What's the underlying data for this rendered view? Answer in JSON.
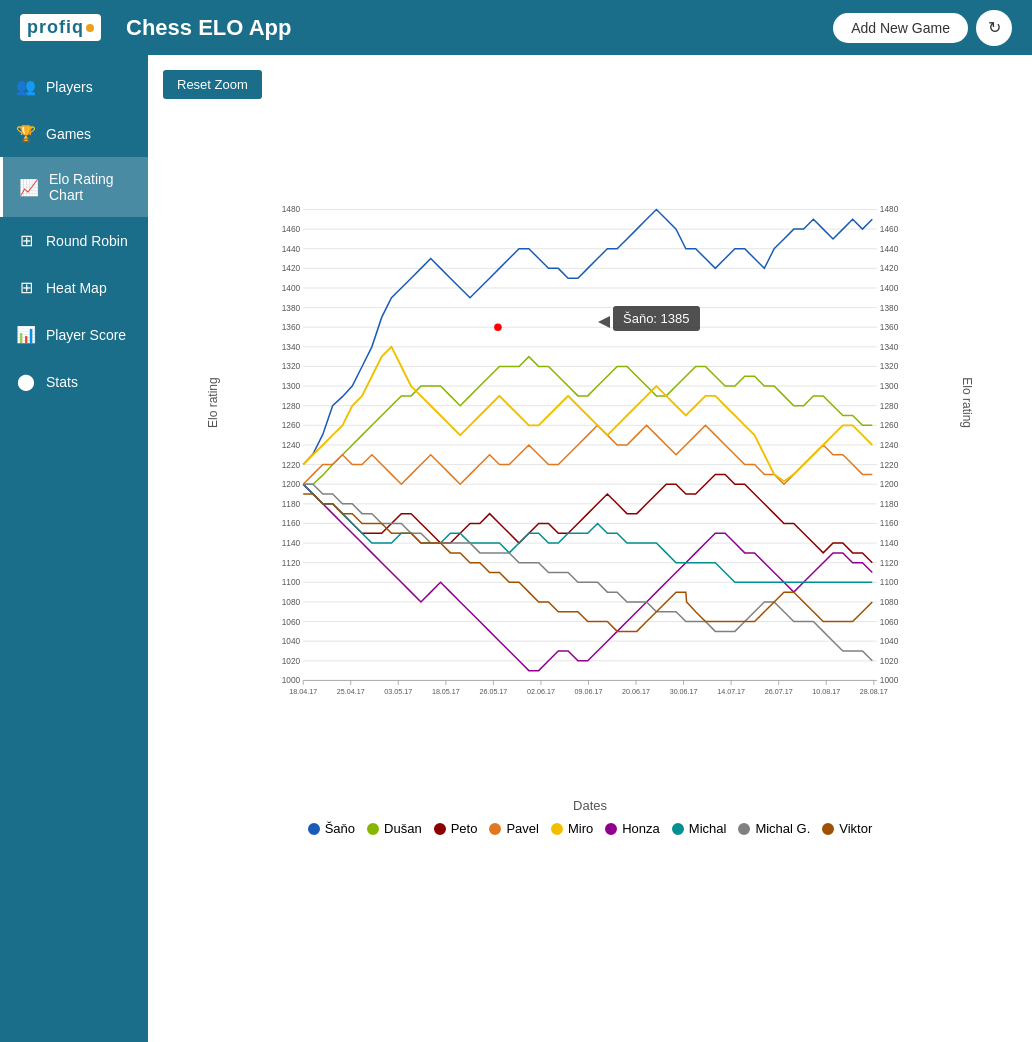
{
  "header": {
    "logo_text": "profiq",
    "app_title": "Chess ELO App",
    "add_game_label": "Add New Game",
    "refresh_icon": "↻"
  },
  "sidebar": {
    "items": [
      {
        "id": "players",
        "label": "Players",
        "icon": "👥",
        "active": false
      },
      {
        "id": "games",
        "label": "Games",
        "icon": "🏆",
        "active": false
      },
      {
        "id": "elo-rating-chart",
        "label": "Elo Rating Chart",
        "icon": "📈",
        "active": true
      },
      {
        "id": "round-robin",
        "label": "Round Robin",
        "icon": "⊞",
        "active": false
      },
      {
        "id": "heat-map",
        "label": "Heat Map",
        "icon": "⊞",
        "active": false
      },
      {
        "id": "player-score",
        "label": "Player Score",
        "icon": "📊",
        "active": false
      },
      {
        "id": "stats",
        "label": "Stats",
        "icon": "⬤",
        "active": false
      }
    ]
  },
  "content": {
    "reset_zoom_label": "Reset Zoom",
    "chart": {
      "y_axis_label": "Elo rating",
      "x_axis_label": "Dates",
      "x_ticks": [
        "18.04.17",
        "25.04.17",
        "03.05.17",
        "18.05.17",
        "26.05.17",
        "02.06.17",
        "09.06.17",
        "20.06.17",
        "30.06.17",
        "14.07.17",
        "26.07.17",
        "10.08.17",
        "28.08.17"
      ],
      "y_min": 1000,
      "y_max": 1480,
      "tooltip_text": "Šaňo: 1385"
    },
    "legend": [
      {
        "name": "Šaňo",
        "color": "#1a5cb5"
      },
      {
        "name": "Dušan",
        "color": "#88b500"
      },
      {
        "name": "Peto",
        "color": "#8b0000"
      },
      {
        "name": "Pavel",
        "color": "#e07820"
      },
      {
        "name": "Miro",
        "color": "#f0c000"
      },
      {
        "name": "Honza",
        "color": "#900090"
      },
      {
        "name": "Michal",
        "color": "#009090"
      },
      {
        "name": "Michal G.",
        "color": "#808080"
      },
      {
        "name": "Viktor",
        "color": "#a05000"
      }
    ]
  }
}
